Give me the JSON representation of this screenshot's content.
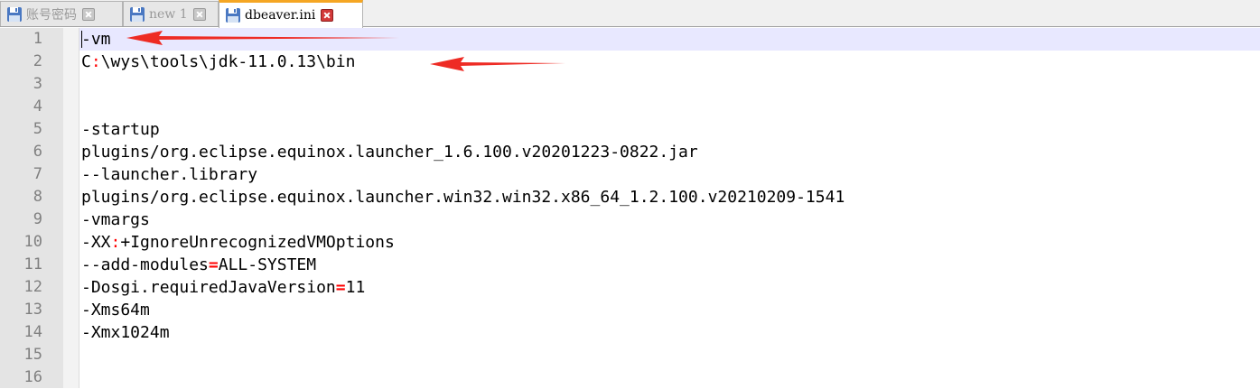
{
  "tabs": [
    {
      "label": "账号密码",
      "active": false
    },
    {
      "label": "new 1",
      "active": false
    },
    {
      "label": "dbeaver.ini",
      "active": true
    }
  ],
  "editor": {
    "current_line": 1,
    "lines": [
      {
        "number": "1",
        "segments": [
          {
            "text": "-vm",
            "kind": "text"
          }
        ]
      },
      {
        "number": "2",
        "segments": [
          {
            "text": "C",
            "kind": "text"
          },
          {
            "text": ":",
            "kind": "op"
          },
          {
            "text": "\\wys\\tools\\jdk-11.0.13\\bin",
            "kind": "text"
          }
        ]
      },
      {
        "number": "3",
        "segments": []
      },
      {
        "number": "4",
        "segments": []
      },
      {
        "number": "5",
        "segments": [
          {
            "text": "-startup",
            "kind": "text"
          }
        ]
      },
      {
        "number": "6",
        "segments": [
          {
            "text": "plugins/org.eclipse.equinox.launcher_1.6.100.v20201223-0822.jar",
            "kind": "text"
          }
        ]
      },
      {
        "number": "7",
        "segments": [
          {
            "text": "--launcher.library",
            "kind": "text"
          }
        ]
      },
      {
        "number": "8",
        "segments": [
          {
            "text": "plugins/org.eclipse.equinox.launcher.win32.win32.x86_64_1.2.100.v20210209-1541",
            "kind": "text"
          }
        ]
      },
      {
        "number": "9",
        "segments": [
          {
            "text": "-vmargs",
            "kind": "text"
          }
        ]
      },
      {
        "number": "10",
        "segments": [
          {
            "text": "-XX",
            "kind": "text"
          },
          {
            "text": ":",
            "kind": "op"
          },
          {
            "text": "+IgnoreUnrecognizedVMOptions",
            "kind": "text"
          }
        ]
      },
      {
        "number": "11",
        "segments": [
          {
            "text": "--add-modules",
            "kind": "text"
          },
          {
            "text": "=",
            "kind": "eq"
          },
          {
            "text": "ALL-SYSTEM",
            "kind": "text"
          }
        ]
      },
      {
        "number": "12",
        "segments": [
          {
            "text": "-Dosgi.requiredJavaVersion",
            "kind": "text"
          },
          {
            "text": "=",
            "kind": "eq"
          },
          {
            "text": "11",
            "kind": "text"
          }
        ]
      },
      {
        "number": "13",
        "segments": [
          {
            "text": "-Xms64m",
            "kind": "text"
          }
        ]
      },
      {
        "number": "14",
        "segments": [
          {
            "text": "-Xmx1024m",
            "kind": "text"
          }
        ]
      },
      {
        "number": "15",
        "segments": []
      },
      {
        "number": "16",
        "segments": []
      }
    ]
  },
  "annotations": {
    "arrow_color": "#ee2b24"
  }
}
